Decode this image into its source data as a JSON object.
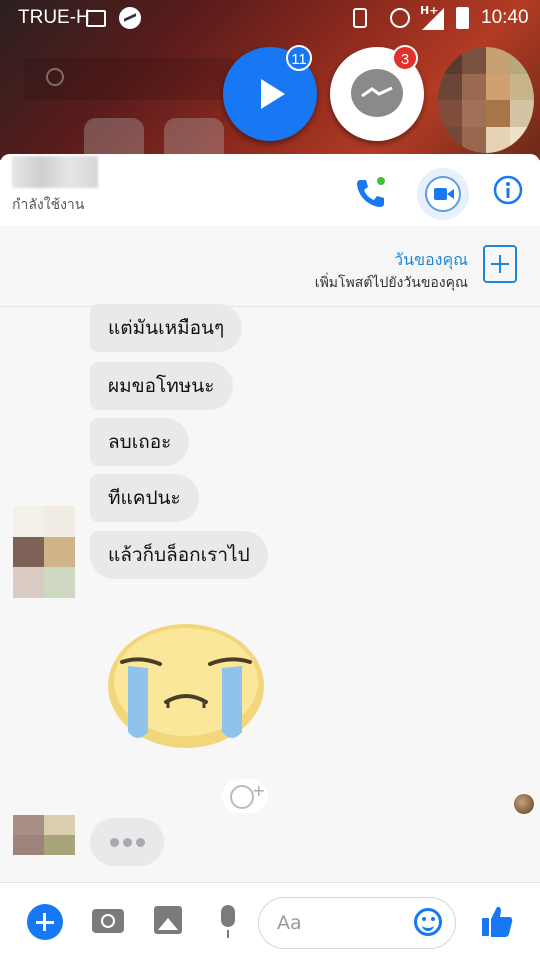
{
  "status_bar": {
    "carrier": "TRUE-H",
    "network_type": "H+",
    "time": "10:40"
  },
  "chat_heads": {
    "video_badge": "11",
    "messenger_badge": "3"
  },
  "conversation": {
    "contact_status": "กำลังใช้งาน",
    "call_icon": "phone-icon",
    "video_icon": "video-camera-icon",
    "info_icon": "info-icon",
    "accent_color": "#1877f2"
  },
  "your_day": {
    "title": "วันของคุณ",
    "subtitle": "เพิ่มโพสต์ไปยังวันของคุณ"
  },
  "messages": [
    {
      "text": "แต่มันเหมือนๆ"
    },
    {
      "text": "ผมขอโทษนะ"
    },
    {
      "text": "ลบเถอะ"
    },
    {
      "text": "ทีแคปนะ"
    },
    {
      "text": "แล้วก็บล็อกเราไป"
    }
  ],
  "sticker": {
    "name": "crying-face-sticker"
  },
  "composer": {
    "placeholder": "Aa"
  }
}
